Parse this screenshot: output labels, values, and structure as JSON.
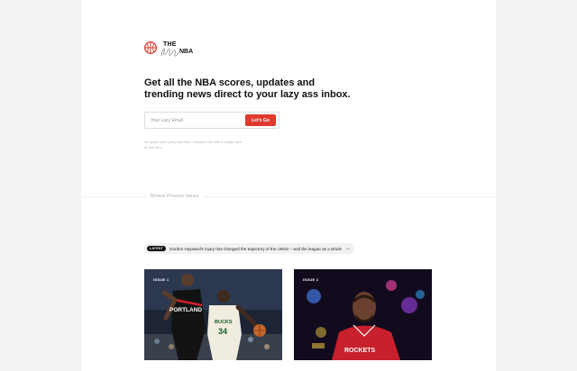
{
  "logo": {
    "the": "THE",
    "nba": "NBA"
  },
  "hero": {
    "headline": "Get all the NBA scores, updates and trending news direct to your lazy ass inbox."
  },
  "signup": {
    "placeholder": "Your Lazy Email",
    "button_label": "Let's Go"
  },
  "note": "No spam ever, just pure NBA. Unsubscribe with a single click at any time.",
  "browse": {
    "label": "Browse Previous Issues"
  },
  "latest": {
    "badge": "LATEST",
    "text": "Gordon Hayward's injury has changed the trajectory of the celtics – and the league as a whole",
    "arrow": "→"
  },
  "issues": [
    {
      "label": "ISSUE 1",
      "jersey_left": "PORTLAND",
      "jersey_right": "BUCKS",
      "number": "34"
    },
    {
      "label": "ISSUE 2",
      "jersey": "ROCKETS"
    }
  ],
  "colors": {
    "accent": "#e03a2f",
    "text": "#111111",
    "background": "#f2f2f2"
  }
}
